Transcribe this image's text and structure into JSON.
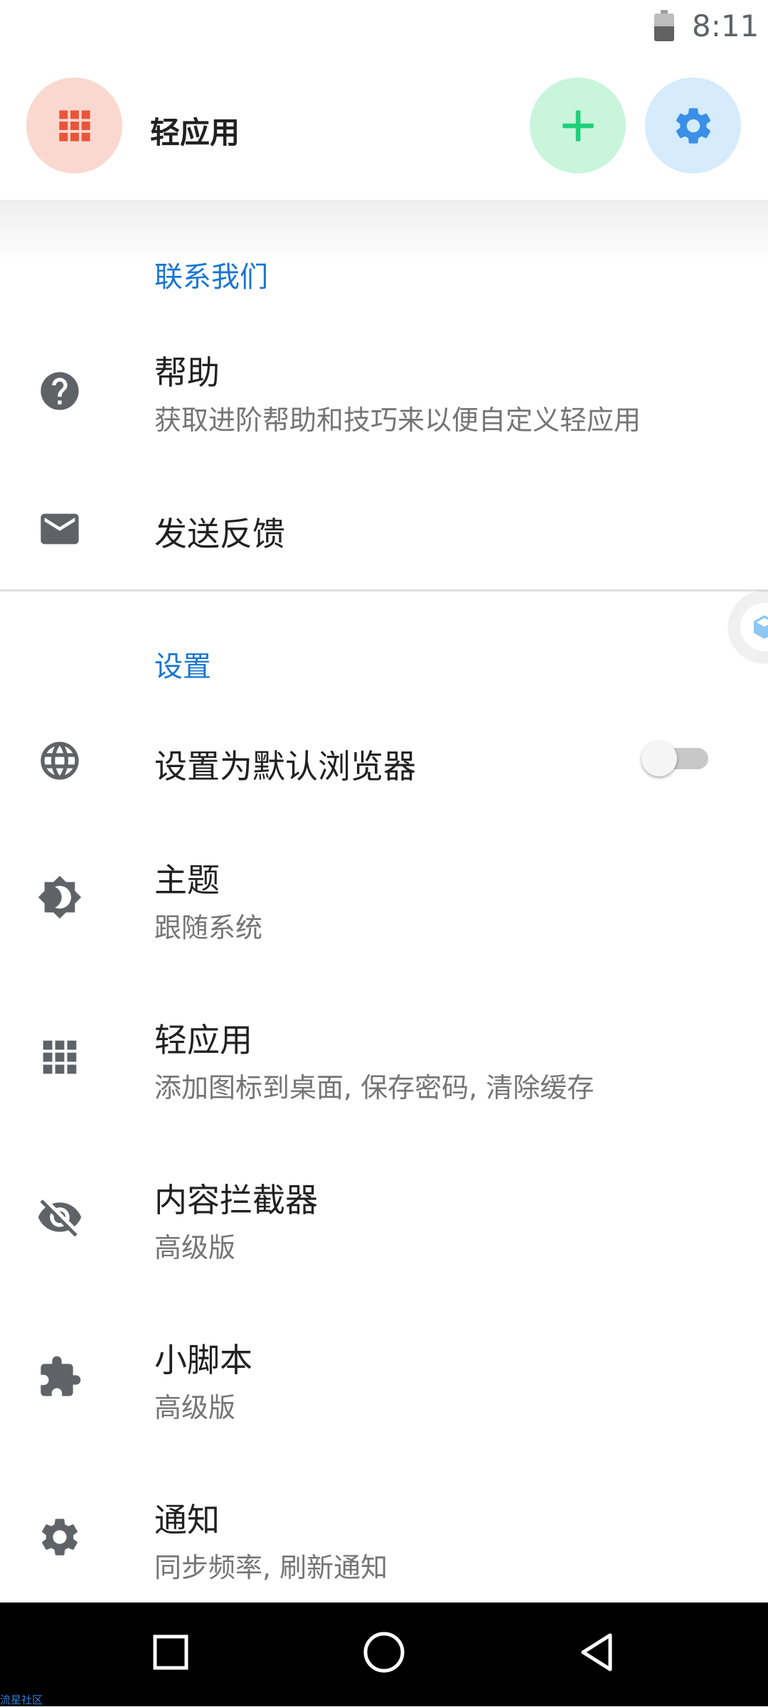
{
  "status_bar": {
    "time": "8:11",
    "battery_level": 0.55
  },
  "app_bar": {
    "title": "轻应用",
    "apps_icon": "apps-grid-icon",
    "add_icon": "plus-icon",
    "settings_icon": "gear-icon"
  },
  "sections": {
    "contact": {
      "header": "联系我们",
      "items": [
        {
          "title": "帮助",
          "subtitle": "获取进阶帮助和技巧来以便自定义轻应用",
          "icon": "help-circle-icon"
        },
        {
          "title": "发送反馈",
          "icon": "mail-icon"
        }
      ]
    },
    "settings": {
      "header": "设置",
      "items": [
        {
          "title": "设置为默认浏览器",
          "icon": "globe-icon",
          "toggle_on": false
        },
        {
          "title": "主题",
          "subtitle": "跟随系统",
          "icon": "theme-icon"
        },
        {
          "title": "轻应用",
          "subtitle": "添加图标到桌面, 保存密码, 清除缓存",
          "icon": "apps-grid-icon"
        },
        {
          "title": "内容拦截器",
          "subtitle": "高级版",
          "icon": "eye-off-icon"
        },
        {
          "title": "小脚本",
          "subtitle": "高级版",
          "icon": "puzzle-icon"
        },
        {
          "title": "通知",
          "subtitle": "同步频率, 刷新通知",
          "icon": "gear-icon"
        }
      ]
    }
  },
  "nav_bar": {
    "recents_icon": "square-icon",
    "home_icon": "circle-icon",
    "back_icon": "triangle-back-icon"
  },
  "watermark": "流星社区",
  "colors": {
    "accent_blue": "#1976d2",
    "apps_red": "#e8553a",
    "add_green": "#1fcf7a",
    "settings_blue": "#3b8fe6",
    "icon_grey": "#5f6368"
  }
}
